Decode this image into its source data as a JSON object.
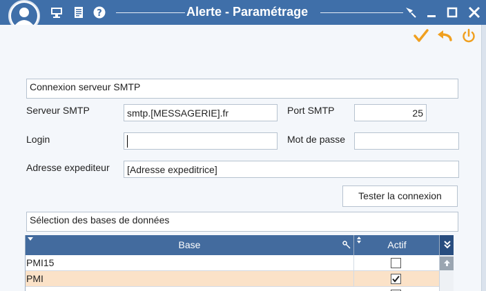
{
  "window": {
    "title": "Alerte - Paramétrage",
    "colors": {
      "titlebar": "#3f6fa9",
      "accent": "#f0a020",
      "grid_header": "#436b9e",
      "selected_row": "#fbe2c8"
    }
  },
  "titlebar_icons": [
    "user-avatar-icon",
    "monitor-icon",
    "document-icon",
    "help-icon"
  ],
  "window_buttons": [
    "pin-icon",
    "minimize-icon",
    "maximize-icon",
    "close-icon"
  ],
  "toolbar": [
    "validate-check-icon",
    "undo-arrow-icon",
    "power-icon"
  ],
  "smtp": {
    "section_title": "Connexion serveur SMTP",
    "server_label": "Serveur SMTP",
    "server_value": "smtp.[MESSAGERIE].fr",
    "port_label": "Port SMTP",
    "port_value": "25",
    "login_label": "Login",
    "login_value": "",
    "password_label": "Mot de passe",
    "password_value": "",
    "sender_label": "Adresse expediteur",
    "sender_value": "[Adresse expeditrice]",
    "test_button": "Tester la connexion"
  },
  "databases": {
    "section_title": "Sélection des bases de données",
    "columns": {
      "base": "Base",
      "actif": "Actif"
    },
    "rows": [
      {
        "base": "PMI15",
        "actif": false,
        "selected": false
      },
      {
        "base": "PMI",
        "actif": true,
        "selected": true
      }
    ]
  }
}
